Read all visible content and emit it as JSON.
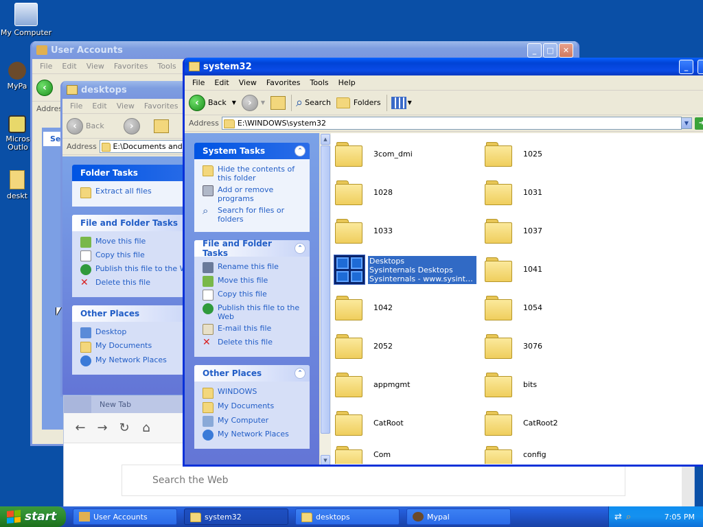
{
  "desktop": {
    "icons": [
      {
        "label": "My Computer"
      },
      {
        "label": "MyPa"
      },
      {
        "label": "Micros Outlo"
      },
      {
        "label": "deskt"
      }
    ]
  },
  "user_accounts": {
    "title": "User Accounts",
    "menu": [
      "File",
      "Edit",
      "View",
      "Favorites",
      "Tools"
    ],
    "address_label": "Addres",
    "partial_text": "Se"
  },
  "desktops": {
    "title": "desktops",
    "menu": [
      "File",
      "Edit",
      "View",
      "Favorites"
    ],
    "back_label": "Back",
    "address_label": "Address",
    "address_value": "E:\\Documents and Se",
    "folder_tasks": {
      "title": "Folder Tasks",
      "items": [
        "Extract all files"
      ]
    },
    "file_tasks": {
      "title": "File and Folder Tasks",
      "items": [
        "Move this file",
        "Copy this file",
        "Publish this file to the Web",
        "Delete this file"
      ]
    },
    "other_places": {
      "title": "Other Places",
      "items": [
        "Desktop",
        "My Documents",
        "My Network Places"
      ]
    }
  },
  "system32": {
    "title": "system32",
    "menu": [
      "File",
      "Edit",
      "View",
      "Favorites",
      "Tools",
      "Help"
    ],
    "toolbar": {
      "back": "Back",
      "search": "Search",
      "folders": "Folders"
    },
    "address_label": "Address",
    "address_value": "E:\\WINDOWS\\system32",
    "system_tasks": {
      "title": "System Tasks",
      "items": [
        "Hide the contents of this folder",
        "Add or remove programs",
        "Search for files or folders"
      ]
    },
    "file_tasks": {
      "title": "File and Folder Tasks",
      "items": [
        "Rename this file",
        "Move this file",
        "Copy this file",
        "Publish this file to the Web",
        "E-mail this file",
        "Delete this file"
      ]
    },
    "other_places": {
      "title": "Other Places",
      "items": [
        "WINDOWS",
        "My Documents",
        "My Computer",
        "My Network Places"
      ]
    },
    "files": [
      "3com_dmi",
      "1025",
      "1028",
      "1031",
      "1033",
      "1037",
      "",
      "1041",
      "1042",
      "1054",
      "2052",
      "3076",
      "appmgmt",
      "bits",
      "CatRoot",
      "CatRoot2",
      "Com",
      "config"
    ],
    "selected": {
      "line1": "Desktops",
      "line2": "Sysinternals Desktops",
      "line3": "Sysinternals - www.sysinterna..."
    }
  },
  "browser": {
    "tab_label": "New Tab",
    "search_placeholder": "Search the Web"
  },
  "taskbar": {
    "start_label": "start",
    "buttons": [
      "User Accounts",
      "system32",
      "desktops",
      "Mypal"
    ],
    "clock": "7:05 PM"
  }
}
